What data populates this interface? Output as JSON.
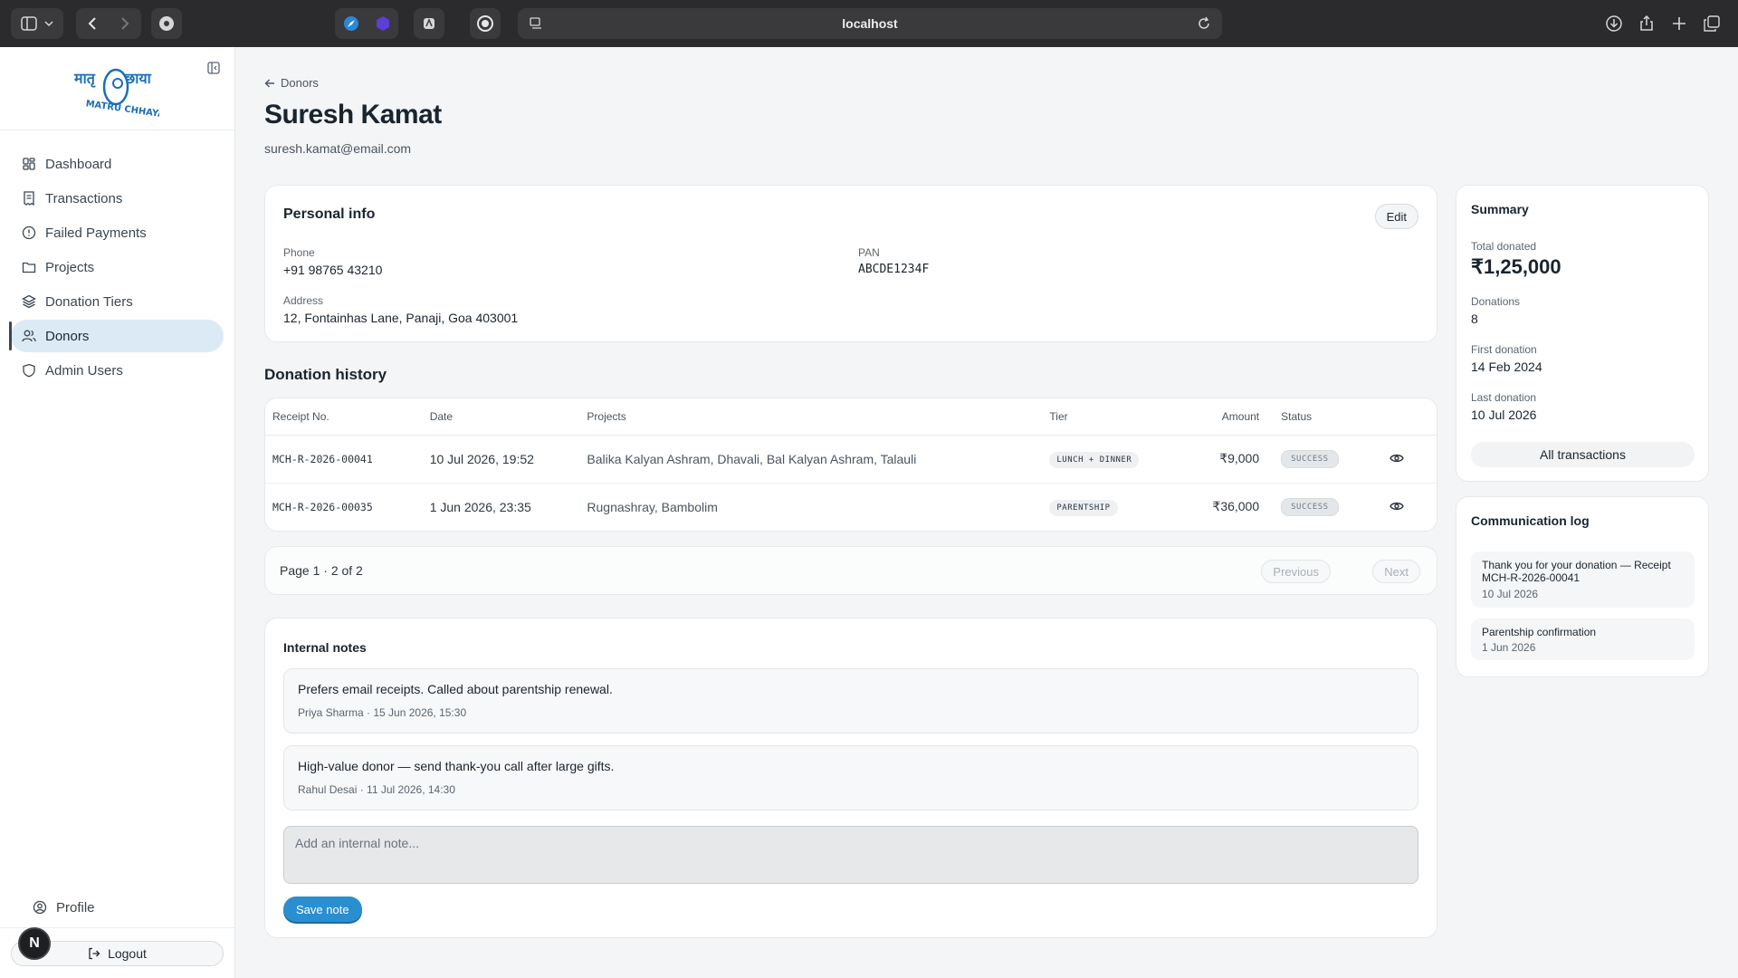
{
  "browser": {
    "url": "localhost"
  },
  "brand": {
    "logo_text_left": "मातृ",
    "logo_text_right": "छाया",
    "logo_text_bottom": "MATRU CHHAYA"
  },
  "sidebar": {
    "items": [
      {
        "label": "Dashboard",
        "icon": "grid-icon"
      },
      {
        "label": "Transactions",
        "icon": "receipt-icon"
      },
      {
        "label": "Failed Payments",
        "icon": "alert-circle-icon"
      },
      {
        "label": "Projects",
        "icon": "folder-icon"
      },
      {
        "label": "Donation Tiers",
        "icon": "layers-icon"
      },
      {
        "label": "Donors",
        "icon": "users-icon",
        "active": true
      },
      {
        "label": "Admin Users",
        "icon": "shield-icon"
      }
    ],
    "profile_label": "Profile",
    "logout_label": "Logout",
    "avatar_initial": "N"
  },
  "page": {
    "breadcrumb": "Donors",
    "title": "Suresh Kamat",
    "email": "suresh.kamat@email.com"
  },
  "personal_info": {
    "title": "Personal info",
    "edit_label": "Edit",
    "phone_label": "Phone",
    "phone": "+91 98765 43210",
    "pan_label": "PAN",
    "pan": "ABCDE1234F",
    "address_label": "Address",
    "address": "12, Fontainhas Lane, Panaji, Goa 403001"
  },
  "donation_history": {
    "title": "Donation history",
    "columns": [
      "Receipt No.",
      "Date",
      "Projects",
      "Tier",
      "Amount",
      "Status"
    ],
    "rows": [
      {
        "receipt": "MCH-R-2026-00041",
        "date": "10 Jul 2026, 19:52",
        "projects": "Balika Kalyan Ashram, Dhavali, Bal Kalyan Ashram, Talauli",
        "tier": "LUNCH + DINNER",
        "amount": "₹9,000",
        "status": "SUCCESS"
      },
      {
        "receipt": "MCH-R-2026-00035",
        "date": "1 Jun 2026, 23:35",
        "projects": "Rugnashray, Bambolim",
        "tier": "PARENTSHIP",
        "amount": "₹36,000",
        "status": "SUCCESS"
      }
    ],
    "pager_text": "Page 1 · 2 of 2",
    "prev_label": "Previous",
    "next_label": "Next"
  },
  "internal_notes": {
    "title": "Internal notes",
    "notes": [
      {
        "text": "Prefers email receipts. Called about parentship renewal.",
        "meta": "Priya Sharma · 15 Jun 2026, 15:30"
      },
      {
        "text": "High-value donor — send thank-you call after large gifts.",
        "meta": "Rahul Desai · 11 Jul 2026, 14:30"
      }
    ],
    "placeholder": "Add an internal note...",
    "save_label": "Save note"
  },
  "summary": {
    "title": "Summary",
    "total_label": "Total donated",
    "total": "₹1,25,000",
    "donations_label": "Donations",
    "donations": "8",
    "first_label": "First donation",
    "first": "14 Feb 2024",
    "last_label": "Last donation",
    "last": "10 Jul 2026",
    "all_tx_label": "All transactions"
  },
  "comm_log": {
    "title": "Communication log",
    "items": [
      {
        "title": "Thank you for your donation — Receipt MCH-R-2026-00041",
        "date": "10 Jul 2026"
      },
      {
        "title": "Parentship confirmation",
        "date": "1 Jun 2026"
      }
    ]
  }
}
